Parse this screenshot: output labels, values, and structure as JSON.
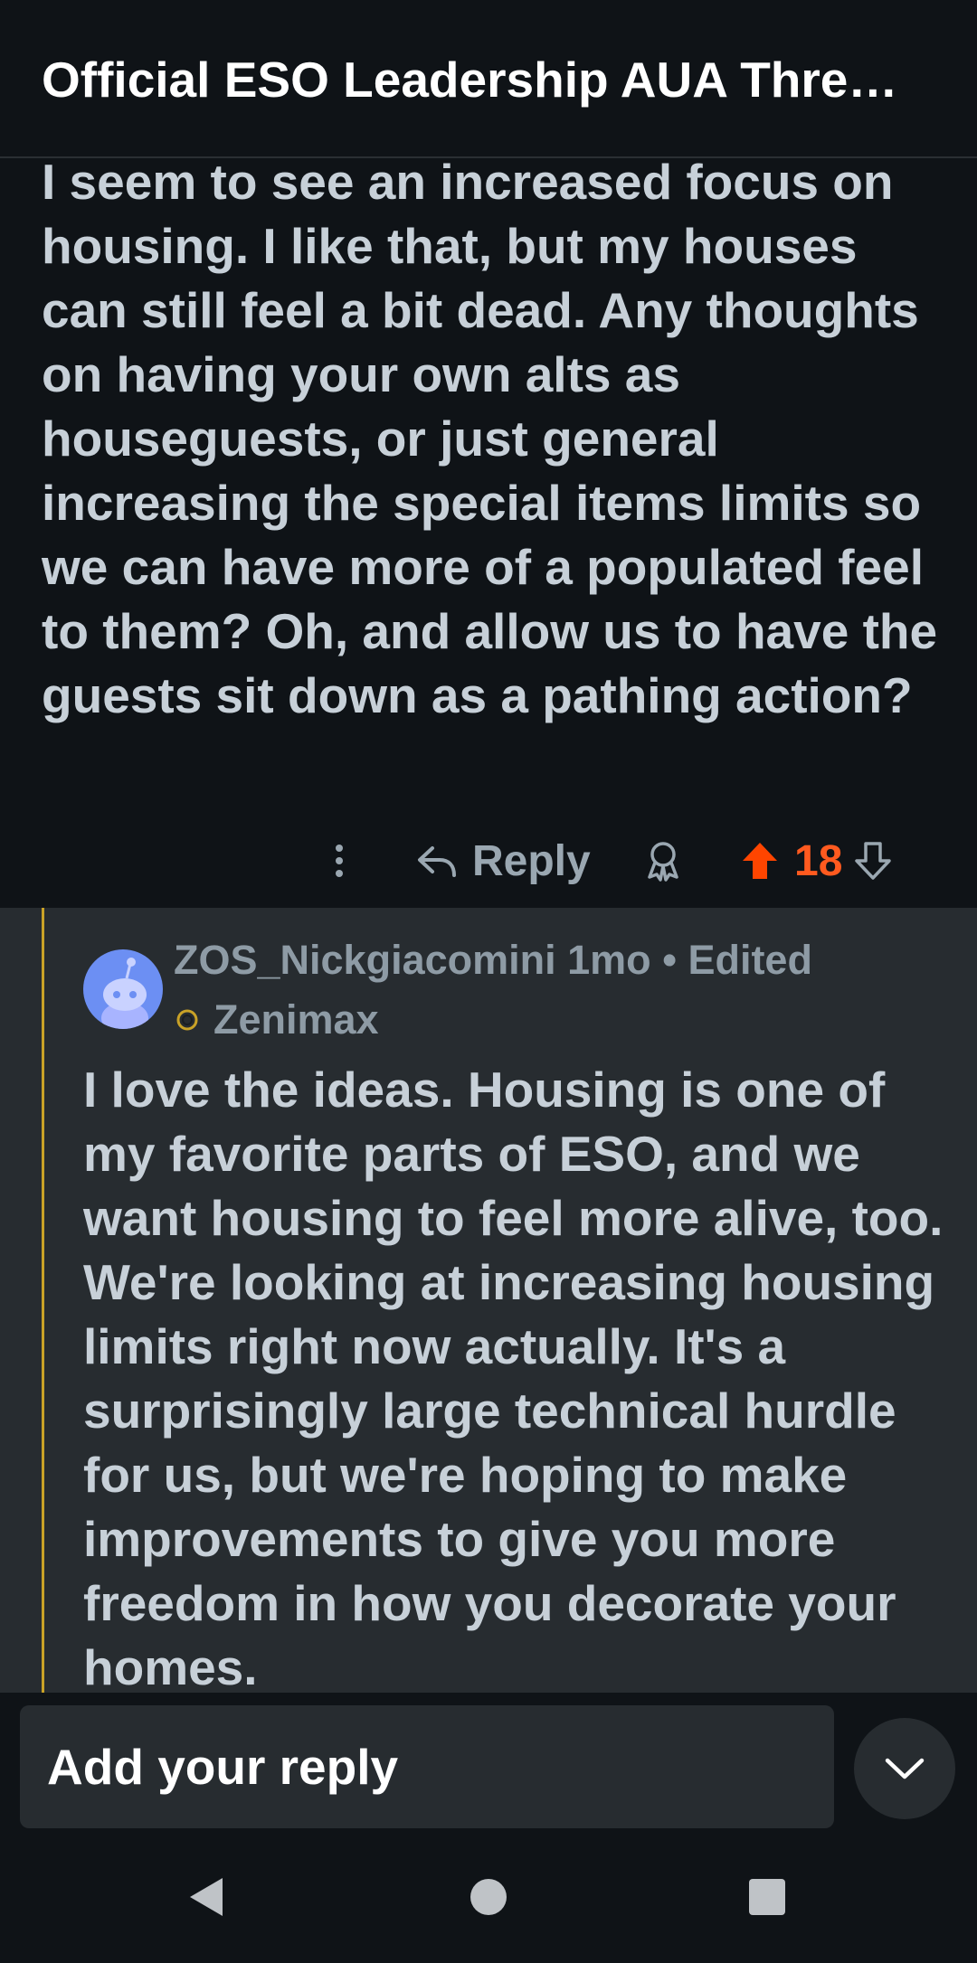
{
  "header": {
    "title": "Official ESO Leadership AUA Thre…"
  },
  "post": {
    "body": "I seem to see an increased focus on housing. I like that, but my houses can still feel a bit dead. Any thoughts on having your own alts as houseguests, or just general increasing the special items limits so we can have more of a populated feel to them? Oh, and allow us to have the guests sit down as a pathing action?",
    "actions": {
      "more_icon": "vertical-dots-icon",
      "reply_label": "Reply",
      "award_icon": "award-icon",
      "score": "18",
      "upvote_color": "#ff4500"
    }
  },
  "reply": {
    "author": "ZOS_Nickgiacomini",
    "age": "1mo",
    "edited": "• Edited",
    "flair": "Zenimax",
    "thread_line_color": "#c9a227",
    "body": "I love the ideas. Housing is one of my favorite parts of ESO, and we want housing to feel more alive, too. We're looking at increasing housing limits right now actually. It's a surprisingly large technical hurdle for us, but we're hoping to make improvements to give you more freedom in how you decorate your homes."
  },
  "composer": {
    "placeholder": "Add your reply"
  },
  "navbar": {
    "back": "back-triangle-icon",
    "home": "home-circle-icon",
    "recents": "recents-square-icon"
  }
}
